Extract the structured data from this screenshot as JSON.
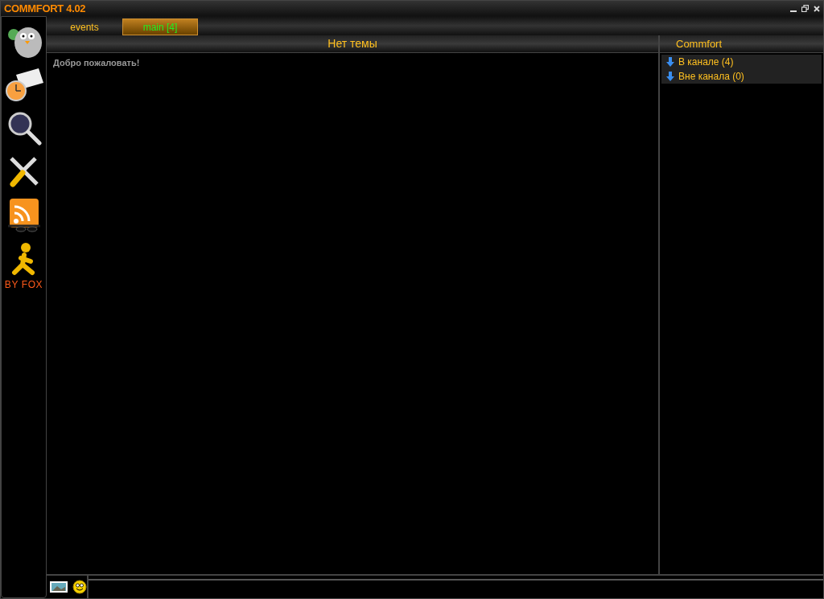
{
  "window": {
    "title": "COMMFORT 4.02"
  },
  "tabs": [
    {
      "label": "events",
      "selected": false
    },
    {
      "label": "main [4]",
      "selected": true
    }
  ],
  "topic": "Нет темы",
  "messages": [
    "Добро пожаловать!"
  ],
  "sidebar": {
    "caption": "BY FOX"
  },
  "user_panel": {
    "header": "Commfort",
    "groups": [
      "В канале (4)",
      "Вне канала (0)"
    ]
  }
}
